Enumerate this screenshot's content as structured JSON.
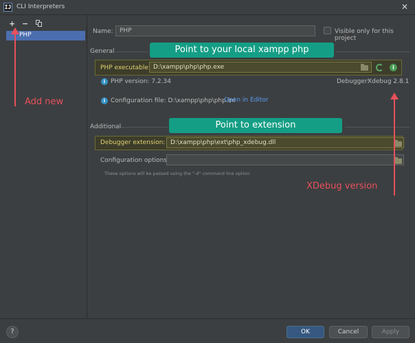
{
  "window": {
    "title": "CLI Interpreters",
    "app_icon_glyph": "IJ"
  },
  "left_panel": {
    "toolbar": {
      "add": "+",
      "remove": "−"
    },
    "interpreters": [
      {
        "label": "PHP"
      }
    ]
  },
  "form": {
    "name_label": "Name:",
    "name_value": "PHP",
    "visible_only_label": "Visible only for this project",
    "visible_only_checked": false,
    "general_section": "General",
    "php_exec_label": "PHP executable:",
    "php_exec_value": "D:\\xampp\\php\\php.exe",
    "php_version_text": "PHP version: 7.2.34",
    "debugger_label": "Debugger:",
    "debugger_value": "Xdebug 2.8.1",
    "config_file_text": "Configuration file: D:\\xampp\\php\\php.ini",
    "open_in_editor": "Open in Editor",
    "additional_section": "Additional",
    "debugger_ext_label": "Debugger extension:",
    "debugger_ext_value": "D:\\xampp\\php\\ext\\php_xdebug.dll",
    "config_options_label": "Configuration options:",
    "config_options_value": "",
    "hint_text": "These options will be passed using the \"-d\" command line option"
  },
  "annotations": {
    "banner_php": "Point to your local xampp php",
    "banner_ext": "Point to extension",
    "add_new": "Add new",
    "xdebug_version": "XDebug version"
  },
  "footer": {
    "help": "?",
    "ok": "OK",
    "cancel": "Cancel",
    "apply": "Apply"
  },
  "colors": {
    "accent": "#4b6eaf",
    "annotation_red": "#e8505b",
    "banner_teal": "#149e85",
    "highlight": "#6b6b35"
  }
}
